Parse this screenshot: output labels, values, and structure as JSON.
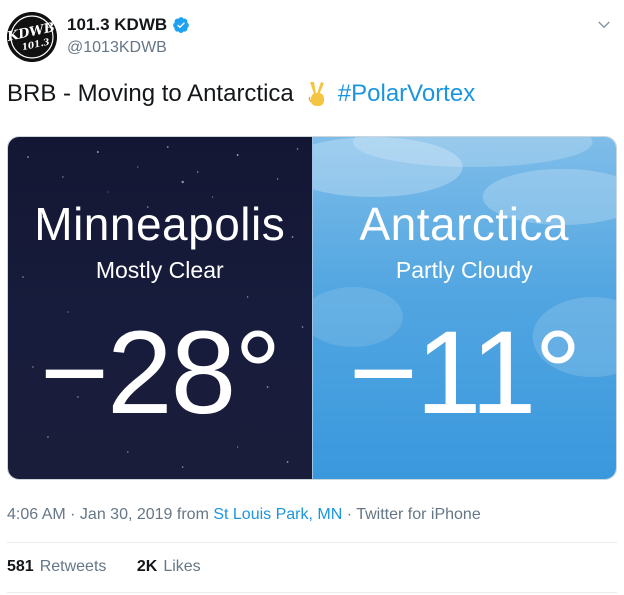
{
  "account": {
    "display_name": "101.3 KDWB",
    "handle": "@1013KDWB",
    "avatar_logo": "KDWB 101.3"
  },
  "tweet": {
    "text": "BRB - Moving to Antarctica",
    "hashtag": "#PolarVortex",
    "emoji": "victory-hand"
  },
  "media": {
    "left": {
      "city": "Minneapolis",
      "condition": "Mostly Clear",
      "temp": "−28°"
    },
    "right": {
      "city": "Antarctica",
      "condition": "Partly Cloudy",
      "temp": "−11°"
    }
  },
  "meta": {
    "time_date": "4:06 AM · Jan 30, 2019 from",
    "location": "St Louis Park, MN",
    "source": "· Twitter for iPhone"
  },
  "stats": {
    "retweets_count": "581",
    "retweets_label": "Retweets",
    "likes_count": "2K",
    "likes_label": "Likes"
  },
  "colors": {
    "link": "#1b95e0",
    "muted": "#657786",
    "text": "#14171a"
  }
}
